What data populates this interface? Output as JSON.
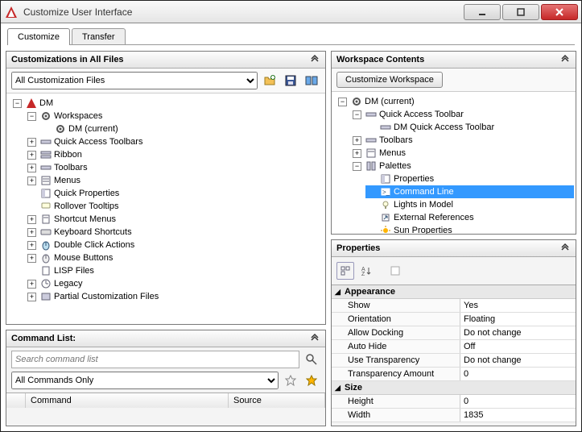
{
  "window": {
    "title": "Customize User Interface"
  },
  "tabs": {
    "customize": "Customize",
    "transfer": "Transfer"
  },
  "customizations": {
    "title": "Customizations in All Files",
    "combo": "All Customization Files",
    "root": "DM",
    "workspaces": "Workspaces",
    "workspace_item": "DM (current)",
    "qat": "Quick Access Toolbars",
    "ribbon": "Ribbon",
    "toolbars": "Toolbars",
    "menus": "Menus",
    "quick_props": "Quick Properties",
    "rollover": "Rollover Tooltips",
    "shortcut_menus": "Shortcut Menus",
    "keyboard": "Keyboard Shortcuts",
    "dbl_click": "Double Click Actions",
    "mouse": "Mouse Buttons",
    "lisp": "LISP Files",
    "legacy": "Legacy",
    "partial": "Partial Customization Files"
  },
  "commandlist": {
    "title": "Command List:",
    "search_placeholder": "Search command list",
    "filter": "All Commands Only",
    "col_command": "Command",
    "col_source": "Source"
  },
  "workspace_contents": {
    "title": "Workspace Contents",
    "btn": "Customize Workspace",
    "root": "DM (current)",
    "qat": "Quick Access Toolbar",
    "qat_item": "DM Quick Access Toolbar",
    "toolbars": "Toolbars",
    "menus": "Menus",
    "palettes": "Palettes",
    "p_properties": "Properties",
    "p_command_line": "Command Line",
    "p_lights": "Lights in Model",
    "p_extref": "External References",
    "p_sun": "Sun Properties"
  },
  "properties": {
    "title": "Properties",
    "cat_appearance": "Appearance",
    "cat_size": "Size",
    "rows": {
      "show_k": "Show",
      "show_v": "Yes",
      "orient_k": "Orientation",
      "orient_v": "Floating",
      "dock_k": "Allow Docking",
      "dock_v": "Do not change",
      "autohide_k": "Auto Hide",
      "autohide_v": "Off",
      "transp_k": "Use Transparency",
      "transp_v": "Do not change",
      "transpamt_k": "Transparency Amount",
      "transpamt_v": "0",
      "height_k": "Height",
      "height_v": "0",
      "width_k": "Width",
      "width_v": "1835"
    }
  }
}
